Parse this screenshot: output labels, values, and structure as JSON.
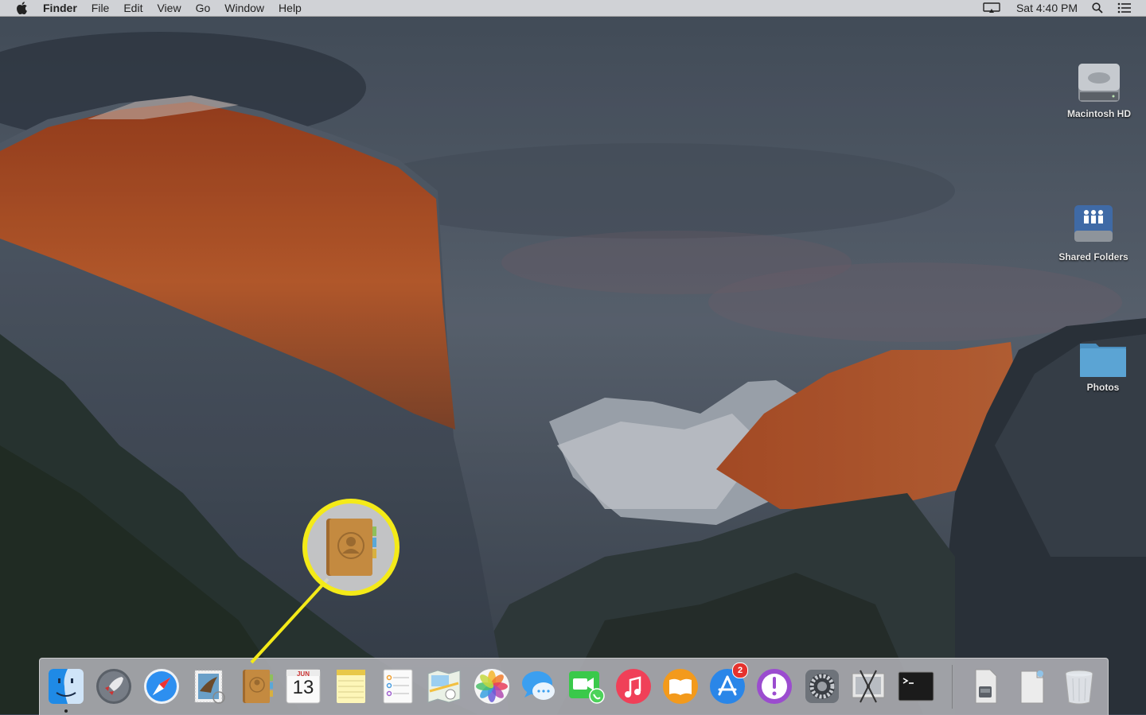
{
  "menubar": {
    "apple_icon": "apple-logo-icon",
    "app_name": "Finder",
    "items": [
      "File",
      "Edit",
      "View",
      "Go",
      "Window",
      "Help"
    ],
    "clock": "Sat 4:40 PM",
    "status_icons": [
      "airplay-display-icon",
      "spotlight-search-icon",
      "notification-center-icon"
    ]
  },
  "desktop": {
    "icons": [
      {
        "label": "Macintosh HD",
        "icon": "hard-drive-icon"
      },
      {
        "label": "Shared Folders",
        "icon": "shared-folders-drive-icon"
      },
      {
        "label": "Photos",
        "icon": "folder-icon"
      }
    ]
  },
  "callout": {
    "highlight_color": "#f4ea18",
    "icon": "contacts-app-icon"
  },
  "dock": {
    "apps": [
      {
        "name": "Finder",
        "icon": "finder-icon",
        "running": true
      },
      {
        "name": "Launchpad",
        "icon": "launchpad-rocket-icon"
      },
      {
        "name": "Safari",
        "icon": "safari-compass-icon"
      },
      {
        "name": "Mail",
        "icon": "mail-stamp-icon"
      },
      {
        "name": "Contacts",
        "icon": "contacts-book-icon"
      },
      {
        "name": "Calendar",
        "icon": "calendar-icon",
        "month": "JUN",
        "day": "13"
      },
      {
        "name": "Notes",
        "icon": "notes-icon"
      },
      {
        "name": "Reminders",
        "icon": "reminders-list-icon"
      },
      {
        "name": "Maps",
        "icon": "maps-icon"
      },
      {
        "name": "Photos",
        "icon": "photos-flower-icon"
      },
      {
        "name": "Messages",
        "icon": "messages-bubble-icon"
      },
      {
        "name": "FaceTime",
        "icon": "facetime-camera-icon"
      },
      {
        "name": "iTunes",
        "icon": "itunes-music-icon"
      },
      {
        "name": "iBooks",
        "icon": "ibooks-icon"
      },
      {
        "name": "App Store",
        "icon": "app-store-icon",
        "badge": "2"
      },
      {
        "name": "Feedback Assistant",
        "icon": "feedback-exclamation-icon"
      },
      {
        "name": "System Preferences",
        "icon": "system-preferences-gear-icon"
      },
      {
        "name": "Screenshot Utility",
        "icon": "scissors-icon"
      },
      {
        "name": "Terminal",
        "icon": "terminal-icon"
      },
      {
        "name": "Downloads",
        "icon": "downloads-stack-icon"
      },
      {
        "name": "Documents",
        "icon": "document-stack-icon"
      },
      {
        "name": "Trash",
        "icon": "trash-icon"
      }
    ]
  },
  "colors": {
    "wallpaper_sky": "#55606e",
    "cliff_orange": "#b5552a",
    "dock_bg": "#b4b4ba",
    "badge_red": "#e5322d"
  }
}
